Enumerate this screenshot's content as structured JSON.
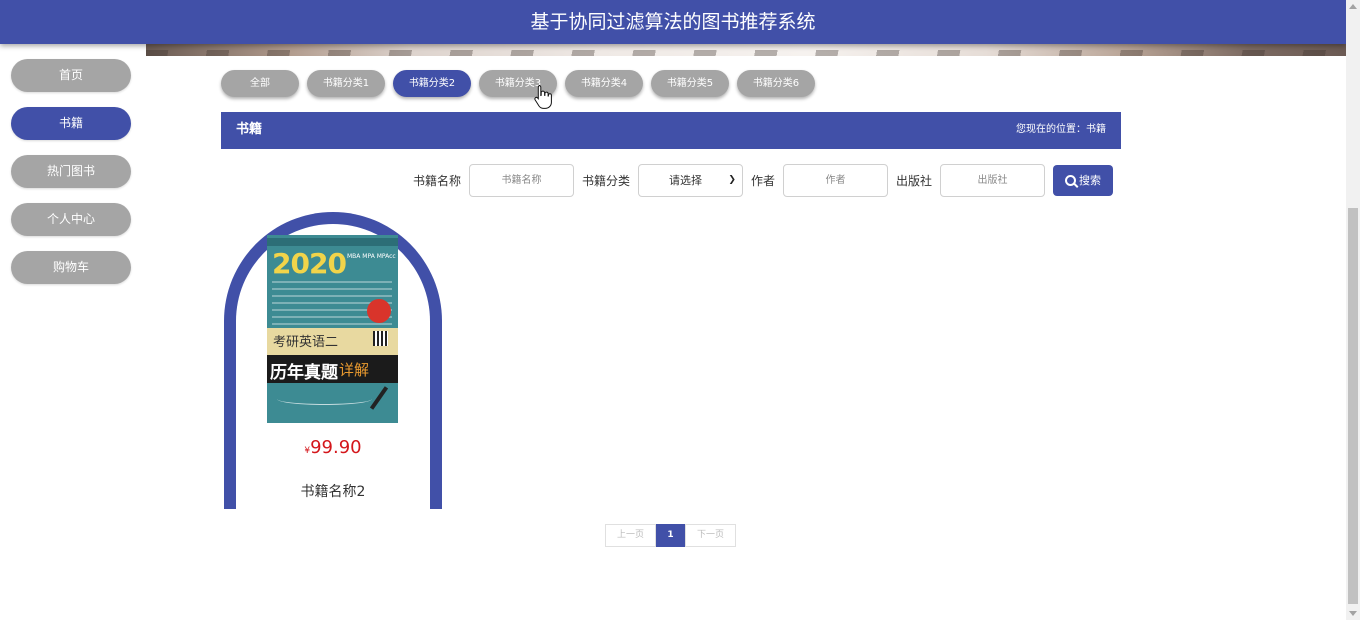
{
  "header": {
    "title": "基于协同过滤算法的图书推荐系统"
  },
  "sidebar": {
    "items": [
      {
        "label": "首页",
        "active": false
      },
      {
        "label": "书籍",
        "active": true
      },
      {
        "label": "热门图书",
        "active": false
      },
      {
        "label": "个人中心",
        "active": false
      },
      {
        "label": "购物车",
        "active": false
      }
    ]
  },
  "categories": {
    "items": [
      {
        "label": "全部",
        "active": false
      },
      {
        "label": "书籍分类1",
        "active": false
      },
      {
        "label": "书籍分类2",
        "active": true
      },
      {
        "label": "书籍分类3",
        "active": false
      },
      {
        "label": "书籍分类4",
        "active": false
      },
      {
        "label": "书籍分类5",
        "active": false
      },
      {
        "label": "书籍分类6",
        "active": false
      }
    ]
  },
  "section": {
    "title": "书籍",
    "location": "您现在的位置：书籍"
  },
  "search": {
    "name_label": "书籍名称",
    "name_placeholder": "书籍名称",
    "category_label": "书籍分类",
    "category_selected": "请选择",
    "author_label": "作者",
    "author_placeholder": "作者",
    "publisher_label": "出版社",
    "publisher_placeholder": "出版社",
    "button_label": "搜索"
  },
  "books": [
    {
      "name": "书籍名称2",
      "currency": "¥",
      "price": "99.90",
      "cover": {
        "year": "2020",
        "series": "MBA MPA MPAcc",
        "subtitle": "考研英语二",
        "title_main": "历年真题",
        "title_accent": "详解"
      }
    }
  ],
  "pagination": {
    "prev": "上一页",
    "current": "1",
    "next": "下一页"
  },
  "colors": {
    "primary": "#4150a8",
    "inactive": "#a5a5a5",
    "price": "#d4161b"
  }
}
